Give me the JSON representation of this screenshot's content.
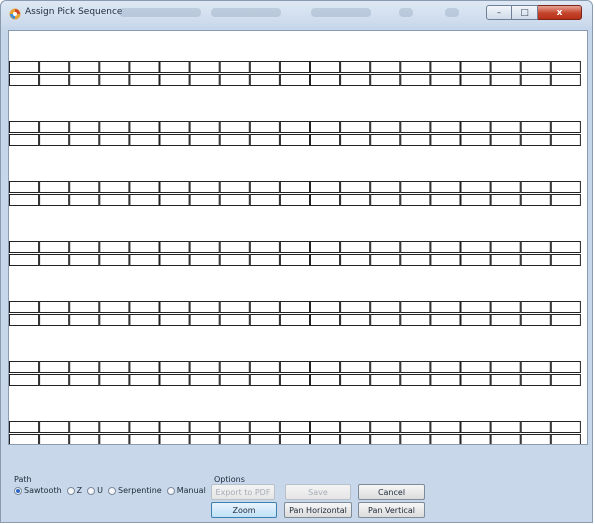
{
  "window": {
    "title": "Assign Pick Sequence",
    "controls": {
      "minimize": "–",
      "maximize": "□",
      "close": "x"
    }
  },
  "path_group": {
    "label": "Path",
    "options": [
      {
        "label": "Sawtooth",
        "checked": true
      },
      {
        "label": "Z",
        "checked": false
      },
      {
        "label": "U",
        "checked": false
      },
      {
        "label": "Serpentine",
        "checked": false
      },
      {
        "label": "Manual",
        "checked": false
      }
    ]
  },
  "options_group": {
    "label": "Options",
    "export_pdf_label": "Export to PDF",
    "save_label": "Save",
    "cancel_label": "Cancel",
    "zoom_label": "Zoom",
    "pan_horizontal_label": "Pan Horizontal",
    "pan_vertical_label": "Pan Vertical"
  },
  "rack_layout": {
    "aisle_count": 7,
    "bays_per_row": 19,
    "rows_per_aisle": 2
  },
  "colors": {
    "frame_bg": "#c8d7ea",
    "canvas_bg": "#ffffff",
    "rack_line": "#222222",
    "active_button": "#bfe0f7",
    "close_button": "#c4442b"
  }
}
